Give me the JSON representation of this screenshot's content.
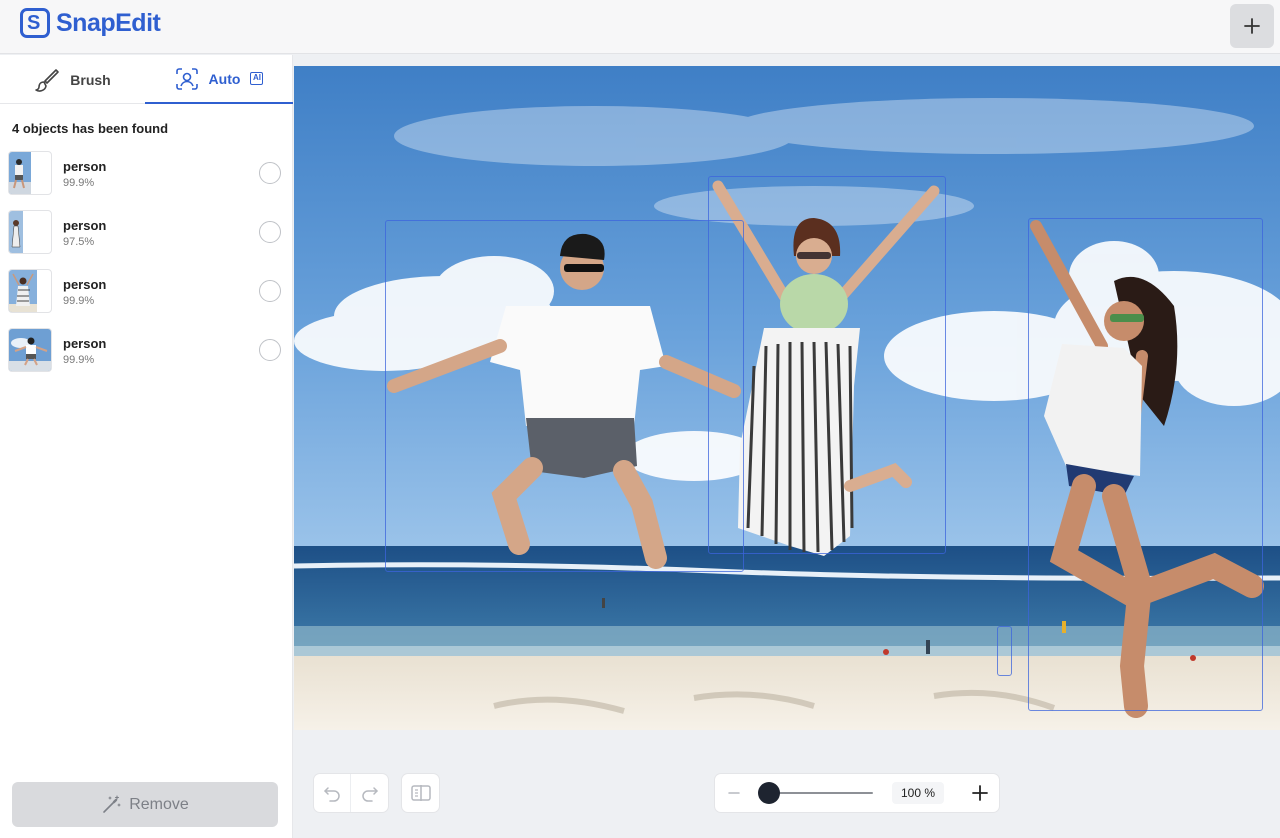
{
  "app": {
    "name": "SnapEdit",
    "logo_letter": "S",
    "brand_color": "#2f5fd0"
  },
  "header": {
    "add_icon": "plus-icon"
  },
  "tabs": [
    {
      "label": "Brush",
      "icon": "brush-icon",
      "active": false
    },
    {
      "label": "Auto",
      "icon": "person-scan-icon",
      "badge": "AI",
      "active": true
    }
  ],
  "detection": {
    "summary": "4 objects has been found",
    "objects": [
      {
        "label": "person",
        "score": "99.9%",
        "selected": false
      },
      {
        "label": "person",
        "score": "97.5%",
        "selected": false
      },
      {
        "label": "person",
        "score": "99.9%",
        "selected": false
      },
      {
        "label": "person",
        "score": "99.9%",
        "selected": false
      }
    ]
  },
  "remove_button": {
    "label": "Remove",
    "icon": "magic-wand-icon",
    "enabled": false
  },
  "toolbar": {
    "undo_icon": "undo-icon",
    "redo_icon": "redo-icon",
    "compare_icon": "compare-icon",
    "zoom_out_icon": "minus-icon",
    "zoom_in_icon": "plus-icon",
    "zoom_value": "100 %"
  }
}
